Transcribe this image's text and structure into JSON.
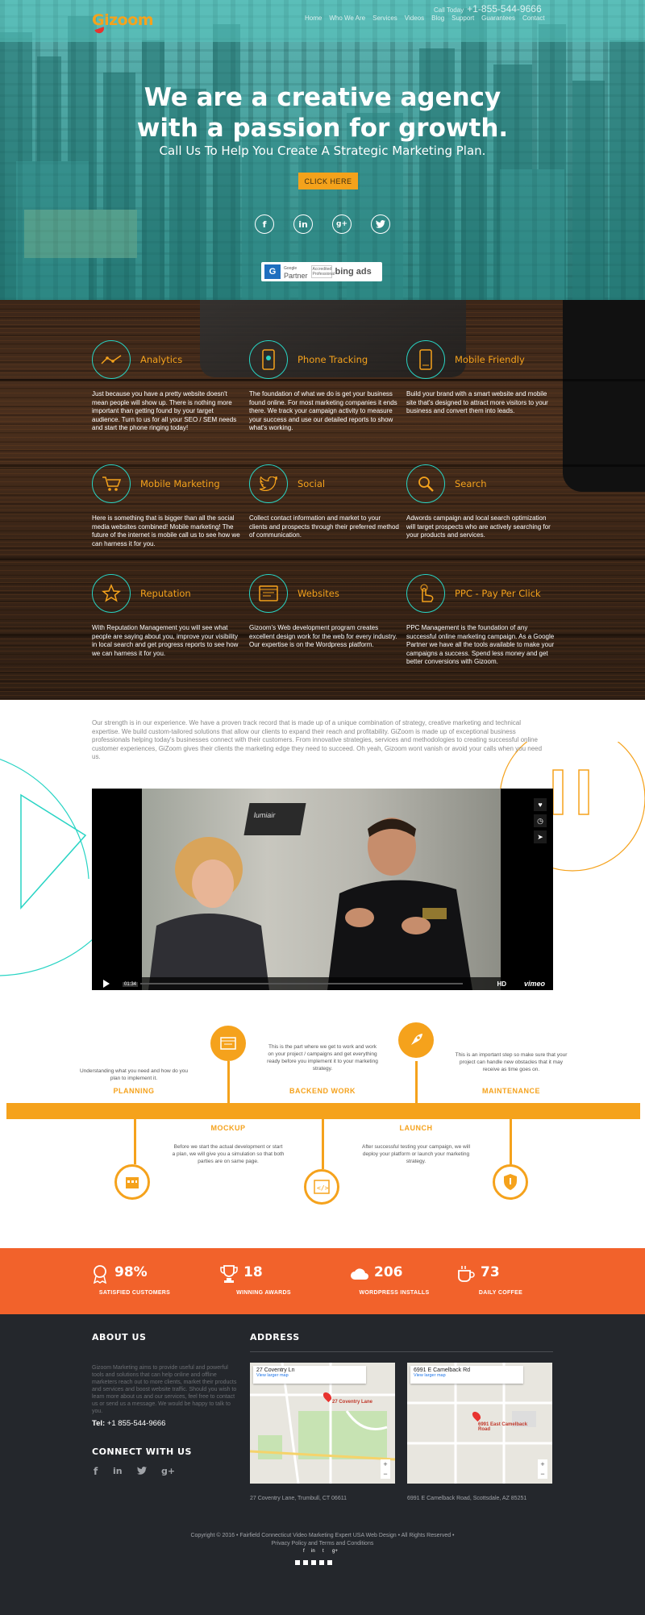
{
  "header": {
    "logo": "Gizoom",
    "phone_prefix": "Call Today",
    "phone": "+1-855-544-9666",
    "nav": [
      "Home",
      "Who We Are",
      "Services",
      "Videos",
      "Blog",
      "Support",
      "Guarantees",
      "Contact"
    ]
  },
  "hero": {
    "title_line1": "We are a creative agency",
    "title_line2": "with a passion for growth.",
    "subtitle": "Call Us To Help You Create A Strategic Marketing Plan.",
    "cta": "CLICK HERE",
    "social": [
      "facebook-icon",
      "linkedin-icon",
      "googleplus-icon",
      "twitter-icon"
    ],
    "badges": {
      "google_small": "Google",
      "google_big": "Partner",
      "accredited": "Accredited Professional",
      "bing": "bing ads"
    }
  },
  "services": [
    {
      "title": "Analytics",
      "icon": "analytics-icon",
      "text": "Just because you have a pretty website doesn't mean people will show up. There is nothing more important than getting found by your target audience. Turn to us for all your SEO / SEM needs and start the phone ringing today!"
    },
    {
      "title": "Phone Tracking",
      "icon": "phone-tracking-icon",
      "text": "The foundation of what we do is get your business found online. For most marketing companies it ends there. We track your campaign activity to measure your success and use our detailed reports to show what's working."
    },
    {
      "title": "Mobile Friendly",
      "icon": "mobile-icon",
      "text": "Build your brand with a smart website and mobile site that's designed to attract more visitors to your business and convert them into leads."
    },
    {
      "title": "Mobile Marketing",
      "icon": "cart-icon",
      "text": "Here is something that is bigger than all the social media websites combined! Mobile marketing! The future of the internet is mobile call us to see how we can harness it for you."
    },
    {
      "title": "Social",
      "icon": "twitter-bird-icon",
      "text": "Collect contact information and market to your clients and prospects through their preferred method of communication."
    },
    {
      "title": "Search",
      "icon": "search-icon",
      "text": "Adwords campaign and local search optimization will target prospects who are actively searching for your products and services."
    },
    {
      "title": "Reputation",
      "icon": "star-icon",
      "text": "With Reputation Management you will see what people are saying about you, improve your visibility in local search and get progress reports to see how we can harness it for you."
    },
    {
      "title": "Websites",
      "icon": "website-icon",
      "text": "Gizoom's Web development program creates excellent design work for the web for every industry. Our expertise is on the Wordpress platform."
    },
    {
      "title": "PPC - Pay Per Click",
      "icon": "click-hand-icon",
      "text": "PPC Management is the foundation of any successful online marketing campaign. As a Google Partner we have all the tools available to make your campaigns a success. Spend less money and get better conversions with Gizoom."
    }
  ],
  "strength": "Our strength is in our experience. We have a proven track record that is made up of a unique combination of strategy, creative marketing and technical expertise. We build custom-tailored solutions that allow our clients to expand their reach and profitability. GiZoom is made up of exceptional business professionals helping today's businesses connect with their customers. From innovative strategies, services and methodologies to creating successful online customer experiences, GiZoom gives their clients the marketing edge they need to succeed. Oh yeah, Gizoom wont vanish or avoid your calls when you need us.",
  "video": {
    "time": "01:34",
    "hd": "HD",
    "brand": "vimeo",
    "banner": "lumiair"
  },
  "process": {
    "planning": {
      "title": "PLANNING",
      "text": "Understanding what you need and how do you plan to implement it."
    },
    "backend": {
      "title": "BACKEND WORK",
      "text": "This is the part where we get to work and work on your project / campaigns and get everything ready before you implement it to your marketing strategy."
    },
    "maintenance": {
      "title": "MAINTENANCE",
      "text": "This is an important step so make sure that your project can handle new obstacles that it may receive as time goes on."
    },
    "mockup": {
      "title": "MOCKUP",
      "text": "Before we start the actual development or start a plan, we will give you a simulation so that both parties are on same page."
    },
    "launch": {
      "title": "LAUNCH",
      "text": "After successful testing your campaign, we will deploy your platform or launch your marketing strategy."
    }
  },
  "stats": [
    {
      "num": "98%",
      "label": "SATISFIED CUSTOMERS",
      "icon": "ribbon-icon"
    },
    {
      "num": "18",
      "label": "WINNING AWARDS",
      "icon": "trophy-icon"
    },
    {
      "num": "206",
      "label": "WORDPRESS INSTALLS",
      "icon": "cloud-icon"
    },
    {
      "num": "73",
      "label": "DAILY COFFEE",
      "icon": "coffee-icon"
    }
  ],
  "footer": {
    "about_title": "ABOUT US",
    "about_text": "Gizoom Marketing aims to provide useful and powerful tools and solutions that can help online and offline marketers reach out to more clients, market their products and services and boost website traffic. Should you wish to learn more about us and our services, feel free to contact us or send us a message. We would be happy to talk to you.",
    "tel_label": "Tel:",
    "tel": "+1 855-544-9666",
    "connect_title": "CONNECT WITH US",
    "address_title": "ADDRESS",
    "map1": {
      "name": "27 Coventry Ln",
      "link": "View larger map",
      "pin": "27 Coventry Lane",
      "address": "27 Coventry Lane, Trumbull, CT 06611"
    },
    "map2": {
      "name": "6991 E Camelback Rd",
      "link": "View larger map",
      "pin": "6991 East Camelback Road",
      "address": "6991 E Camelback Road, Scottsdale, AZ 85251"
    },
    "copyright": "Copyright © 2016 • Fairfield Connecticut Video Marketing Expert USA Web Design • All Rights Reserved •",
    "links": "Privacy Policy and Terms and Conditions"
  },
  "colors": {
    "accent": "#f5a21c",
    "teal": "#28d4c4",
    "stats_bg": "#f2622b",
    "footer_bg": "#24272c"
  }
}
